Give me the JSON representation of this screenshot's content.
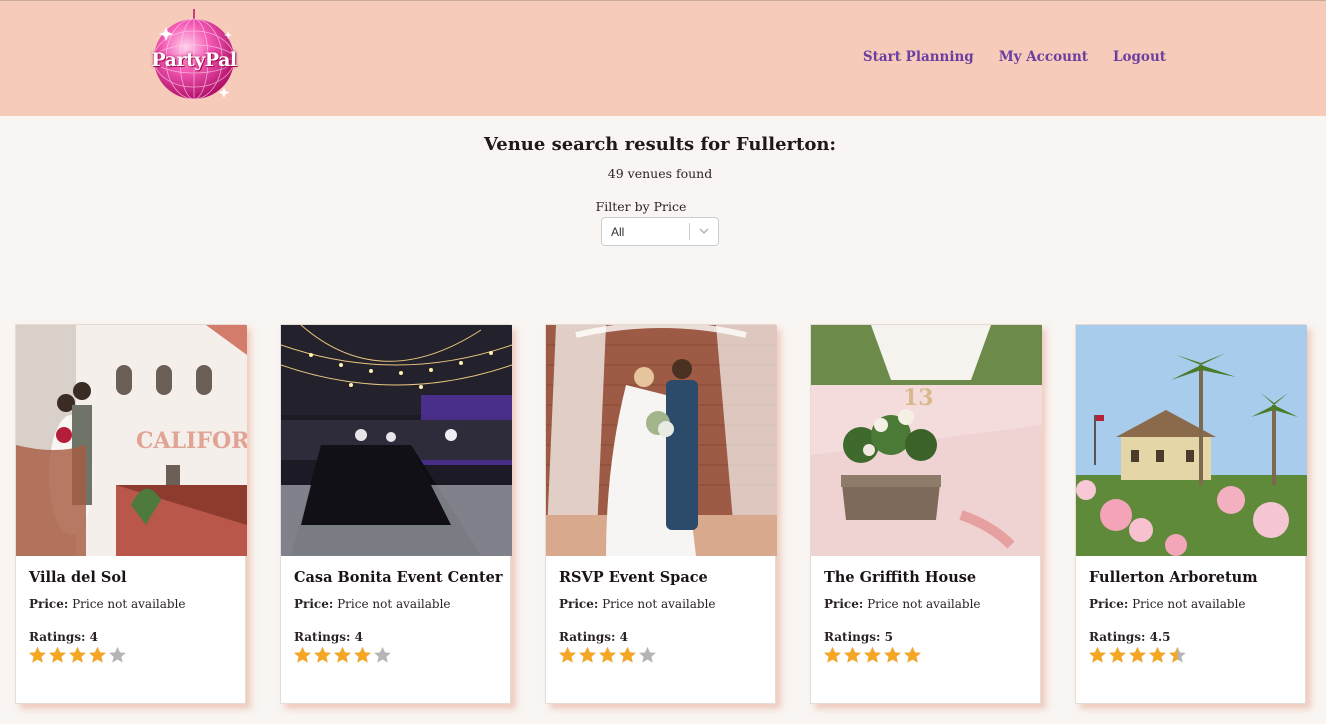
{
  "brand": {
    "logo_text": "PartyPal"
  },
  "nav": {
    "items": [
      {
        "label": "Start Planning"
      },
      {
        "label": "My Account"
      },
      {
        "label": "Logout"
      }
    ]
  },
  "results": {
    "title": "Venue search results for Fullerton:",
    "count_text": "49 venues found"
  },
  "filter": {
    "label": "Filter by Price",
    "selected": "All"
  },
  "colors": {
    "header_bg": "#f6cbb9",
    "nav_link": "#6b3fa0",
    "star_filled": "#f5a623",
    "star_empty": "#b5b5b5"
  },
  "venues": [
    {
      "name": "Villa del Sol",
      "price_label": "Price:",
      "price_value": "Price not available",
      "rating_text": "Ratings: 4",
      "rating": 4,
      "image": "bride-groom-balcony"
    },
    {
      "name": "Casa Bonita Event Center",
      "price_label": "Price:",
      "price_value": "Price not available",
      "rating_text": "Ratings: 4",
      "rating": 4,
      "image": "banquet-hall-string-lights"
    },
    {
      "name": "RSVP Event Space",
      "price_label": "Price:",
      "price_value": "Price not available",
      "rating_text": "Ratings: 4",
      "rating": 4,
      "image": "couple-brick-wall"
    },
    {
      "name": "The Griffith House",
      "price_label": "Price:",
      "price_value": "Price not available",
      "rating_text": "Ratings: 5",
      "rating": 5,
      "image": "floral-centerpiece"
    },
    {
      "name": "Fullerton Arboretum",
      "price_label": "Price:",
      "price_value": "Price not available",
      "rating_text": "Ratings: 4.5",
      "rating": 4.5,
      "image": "garden-house-palms"
    }
  ]
}
